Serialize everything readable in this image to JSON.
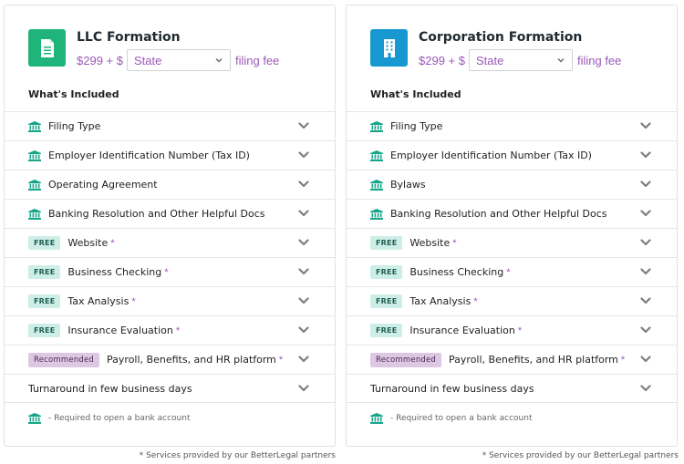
{
  "colors": {
    "llc_icon_bg": "#1fb57a",
    "corp_icon_bg": "#1798d0",
    "accent_purple": "#9b59b6",
    "teal_icon": "#17a589"
  },
  "cards": [
    {
      "title": "LLC Formation",
      "icon": "document-icon",
      "price": "$299 + $",
      "state_select": "State",
      "filing_fee": "filing fee",
      "included_heading": "What's Included",
      "rows": {
        "r0": "Filing Type",
        "r1": "Employer Identification Number (Tax ID)",
        "r2": "Operating Agreement",
        "r3": "Banking Resolution and Other Helpful Docs",
        "r4": "Website",
        "r5": "Business Checking",
        "r6": "Tax Analysis",
        "r7": "Insurance Evaluation",
        "r8": "Payroll, Benefits, and HR platform",
        "r9": "Turnaround in few business days"
      },
      "free_badge": "FREE",
      "recommended_badge": "Recommended",
      "star": "*",
      "note": "- Required to open a bank account",
      "partners_note": "* Services provided by our BetterLegal partners"
    },
    {
      "title": "Corporation Formation",
      "icon": "building-icon",
      "price": "$299 + $",
      "state_select": "State",
      "filing_fee": "filing fee",
      "included_heading": "What's Included",
      "rows": {
        "r0": "Filing Type",
        "r1": "Employer Identification Number (Tax ID)",
        "r2": "Bylaws",
        "r3": "Banking Resolution and Other Helpful Docs",
        "r4": "Website",
        "r5": "Business Checking",
        "r6": "Tax Analysis",
        "r7": "Insurance Evaluation",
        "r8": "Payroll, Benefits, and HR platform",
        "r9": "Turnaround in few business days"
      },
      "free_badge": "FREE",
      "recommended_badge": "Recommended",
      "star": "*",
      "note": "- Required to open a bank account",
      "partners_note": "* Services provided by our BetterLegal partners"
    }
  ]
}
